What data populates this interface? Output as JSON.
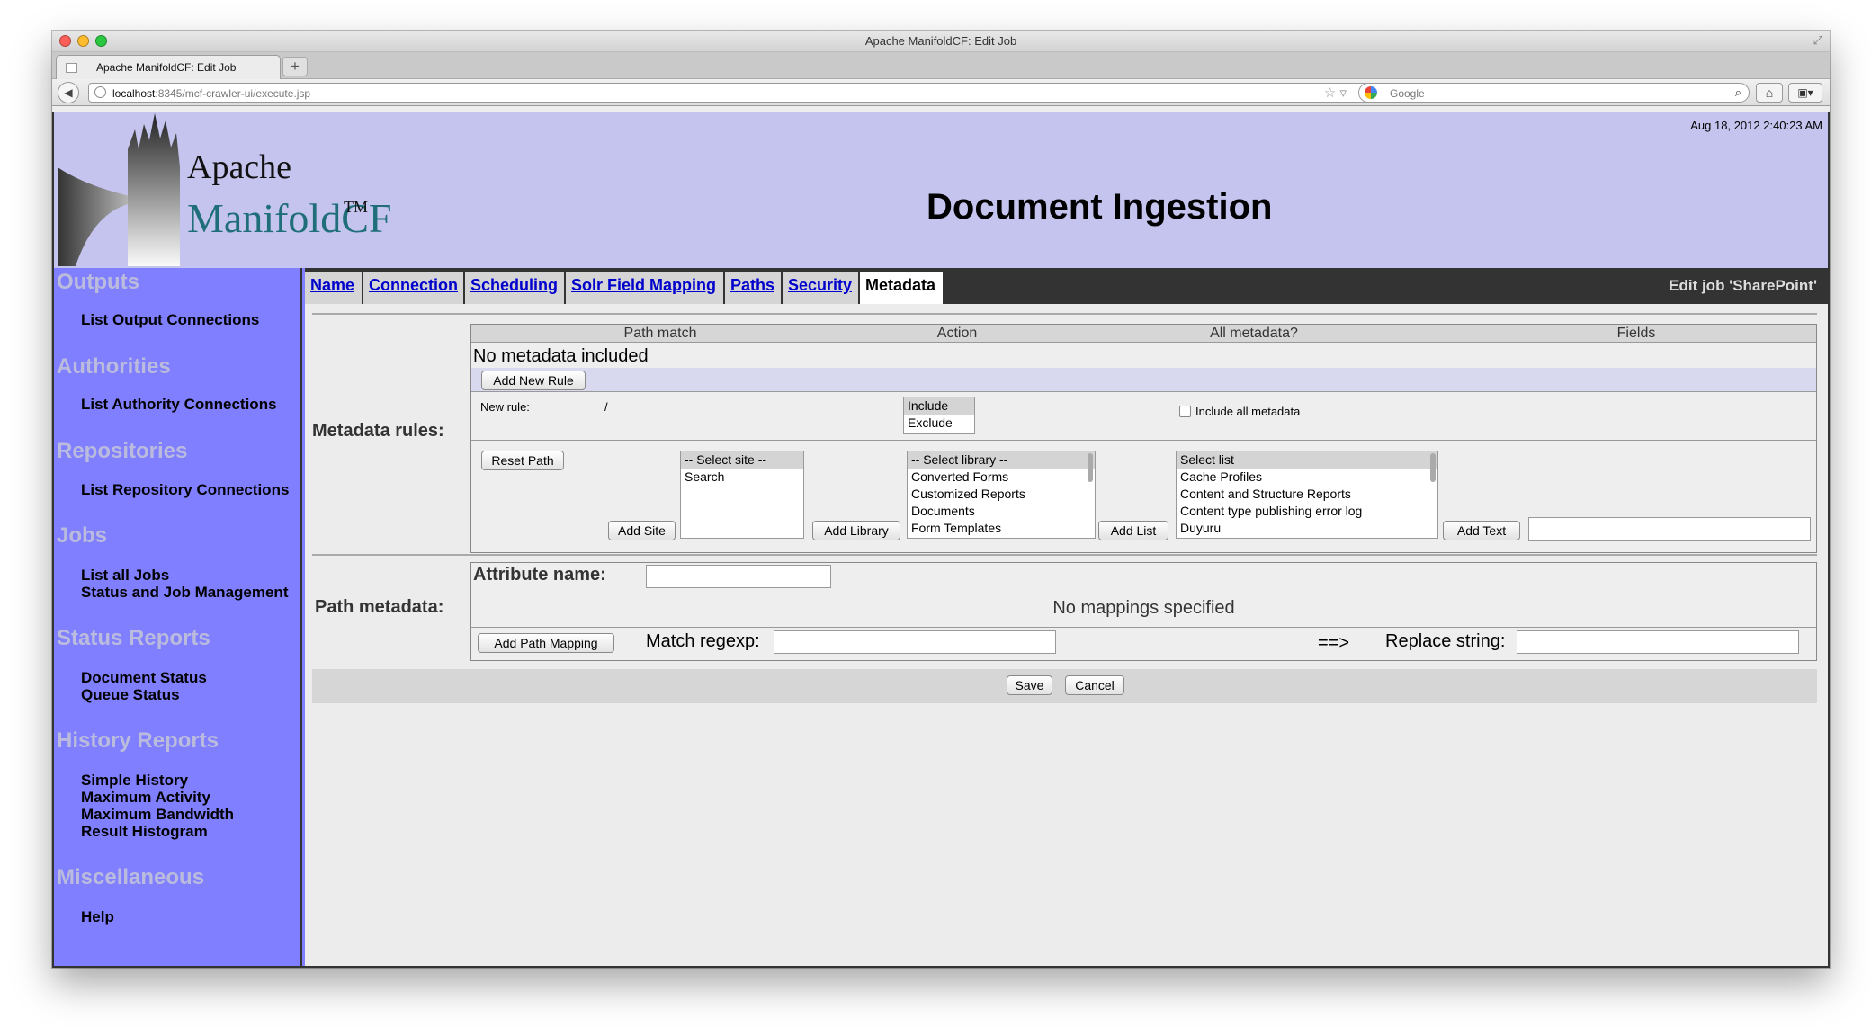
{
  "window": {
    "title": "Apache ManifoldCF: Edit Job"
  },
  "browser": {
    "tab_title": "Apache ManifoldCF: Edit Job",
    "new_tab": "+",
    "url_host": "localhost",
    "url_path": ":8345/mcf-crawler-ui/execute.jsp",
    "search_placeholder": "Google"
  },
  "banner": {
    "logo_line1": "Apache",
    "logo_line2": "ManifoldCF",
    "logo_tm": "TM",
    "title": "Document Ingestion",
    "date": "Aug 18, 2012 2:40:23 AM"
  },
  "sidebar": {
    "outputs": "Outputs",
    "list_output": "List Output Connections",
    "authorities": "Authorities",
    "list_authority": "List Authority Connections",
    "repositories": "Repositories",
    "list_repository": "List Repository Connections",
    "jobs": "Jobs",
    "list_jobs": "List all Jobs",
    "status_jobs": "Status and Job Management",
    "status_reports": "Status Reports",
    "document_status": "Document Status",
    "queue_status": "Queue Status",
    "history_reports": "History Reports",
    "simple_history": "Simple History",
    "max_activity": "Maximum Activity",
    "max_bandwidth": "Maximum Bandwidth",
    "result_histogram": "Result Histogram",
    "miscellaneous": "Miscellaneous",
    "help": "Help"
  },
  "tabs": {
    "name": "Name",
    "connection": "Connection",
    "scheduling": "Scheduling",
    "solr": "Solr Field Mapping",
    "paths": "Paths",
    "security": "Security",
    "metadata": "Metadata",
    "edit_job": "Edit job 'SharePoint'"
  },
  "metadata_rules": {
    "label": "Metadata rules:",
    "col_path_match": "Path match",
    "col_action": "Action",
    "col_all_metadata": "All metadata?",
    "col_fields": "Fields",
    "no_metadata": "No metadata included",
    "add_new_rule": "Add New Rule",
    "new_rule": "New rule:",
    "path_slash": "/",
    "action_options": [
      "Include",
      "Exclude"
    ],
    "include_all_metadata": "Include all metadata",
    "reset_path": "Reset Path",
    "site_options": [
      "-- Select site --",
      "Search"
    ],
    "add_site": "Add Site",
    "library_options": [
      "-- Select library --",
      "Converted Forms",
      "Customized Reports",
      "Documents",
      "Form Templates"
    ],
    "add_library": "Add Library",
    "list_options": [
      "Select list",
      "Cache Profiles",
      "Content and Structure Reports",
      "Content type publishing error log",
      "Duyuru"
    ],
    "add_list": "Add List",
    "add_text": "Add Text"
  },
  "path_metadata": {
    "label": "Path metadata:",
    "attribute_name": "Attribute name:",
    "no_mappings": "No mappings specified",
    "add_path_mapping": "Add Path Mapping",
    "match_regexp": "Match regexp:",
    "arrow": "==>",
    "replace_string": "Replace string:"
  },
  "actions": {
    "save": "Save",
    "cancel": "Cancel"
  }
}
